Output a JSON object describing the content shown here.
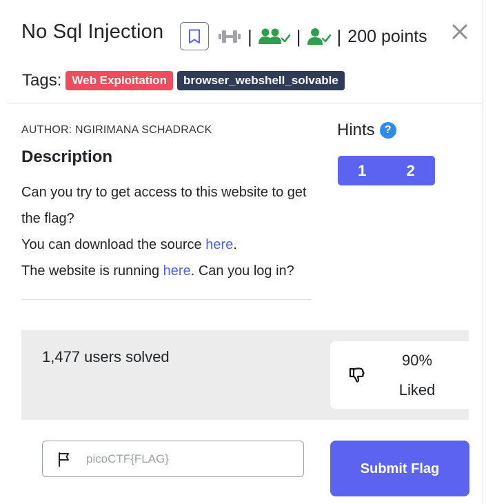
{
  "challenge": {
    "title": "No Sql Injection",
    "points": "200 points",
    "separator": "|"
  },
  "tags": {
    "label": "Tags:",
    "items": [
      {
        "text": "Web Exploitation",
        "color": "#ef4d5b"
      },
      {
        "text": "browser_webshell_solvable",
        "color": "#2f3b57"
      }
    ]
  },
  "author": "AUTHOR: NGIRIMANA SCHADRACK",
  "description": {
    "heading": "Description",
    "line1": "Can you try to get access to this website to get the flag?",
    "line2_pre": "You can download the source ",
    "line2_link": "here",
    "line2_post": ".",
    "line3_pre": "The website is running ",
    "line3_link": "here",
    "line3_post": ". Can you log in?"
  },
  "hints": {
    "heading": "Hints",
    "help_glyph": "?",
    "buttons": [
      "1",
      "2"
    ]
  },
  "stats": {
    "solved": "1,477 users solved",
    "liked_pct": "90%",
    "liked_label": "Liked"
  },
  "flag_form": {
    "placeholder": "picoCTF{FLAG}",
    "submit_label": "Submit Flag"
  },
  "colors": {
    "accent": "#5b63f0",
    "link": "#5160e0",
    "success_green": "#2e9e4f",
    "tag_red": "#ef4d5b",
    "tag_dark": "#2f3b57"
  },
  "icons": [
    "bookmark-icon",
    "dumbbell-icon",
    "users-check-icon",
    "user-check-icon",
    "close-icon",
    "help-icon",
    "thumbs-down-icon",
    "thumbs-up-icon",
    "flag-icon"
  ]
}
